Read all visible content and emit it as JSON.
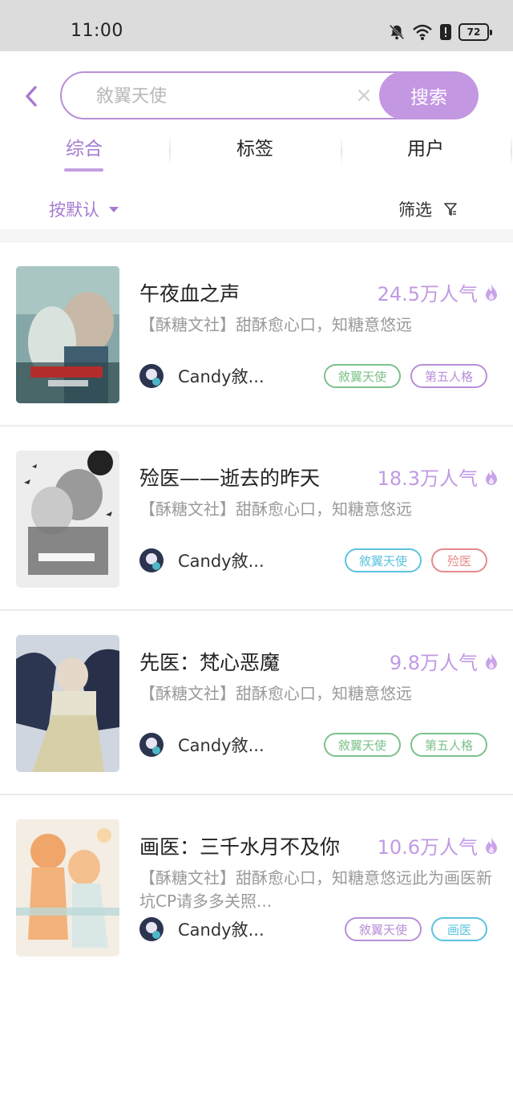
{
  "status_bar": {
    "time": "11:00",
    "battery": "72",
    "icons": [
      "bell-muted-icon",
      "wifi-icon",
      "alert-icon",
      "battery-icon"
    ]
  },
  "search": {
    "value": "",
    "placeholder": "敘翼天使",
    "button_label": "搜索",
    "clear_icon": "×"
  },
  "tabs": [
    {
      "label": "综合",
      "active": true
    },
    {
      "label": "标签",
      "active": false
    },
    {
      "label": "用户",
      "active": false
    }
  ],
  "sort": {
    "label": "按默认"
  },
  "filter": {
    "label": "筛选"
  },
  "books": [
    {
      "title": "午夜血之声",
      "popularity": "24.5万人气",
      "description": "【酥糖文社】甜酥愈心口，知糖意悠远",
      "author": "Candy敘...",
      "tags": [
        {
          "label": "敘翼天使",
          "color": "#7cc18a"
        },
        {
          "label": "第五人格",
          "color": "#b98fd8"
        }
      ]
    },
    {
      "title": "殓医——逝去的昨天",
      "popularity": "18.3万人气",
      "description": "【酥糖文社】甜酥愈心口，知糖意悠远",
      "author": "Candy敘...",
      "tags": [
        {
          "label": "敘翼天使",
          "color": "#5bc3de"
        },
        {
          "label": "殓医",
          "color": "#e58a8a"
        }
      ]
    },
    {
      "title": "先医：梵心恶魔",
      "popularity": "9.8万人气",
      "description": "【酥糖文社】甜酥愈心口，知糖意悠远",
      "author": "Candy敘...",
      "tags": [
        {
          "label": "敘翼天使",
          "color": "#7cc18a"
        },
        {
          "label": "第五人格",
          "color": "#7cc18a"
        }
      ]
    },
    {
      "title": "画医：三千水月不及你",
      "popularity": "10.6万人气",
      "description": "【酥糖文社】甜酥愈心口，知糖意悠远此为画医新坑CP请多多关照...",
      "author": "Candy敘...",
      "tags": [
        {
          "label": "敘翼天使",
          "color": "#b98fd8"
        },
        {
          "label": "画医",
          "color": "#5bc3de"
        }
      ]
    }
  ],
  "colors": {
    "accent": "#b98fd8",
    "accent_text": "#a57bd0",
    "popularity": "#c19ae3",
    "search_button": "#c497e2"
  }
}
